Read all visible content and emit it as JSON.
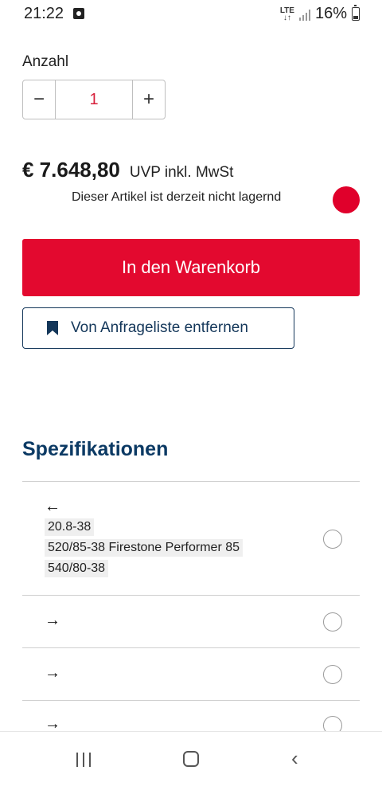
{
  "status_bar": {
    "time": "21:22",
    "network": "LTE",
    "battery": "16%"
  },
  "quantity": {
    "label": "Anzahl",
    "minus": "−",
    "value": "1",
    "plus": "+"
  },
  "price": {
    "amount": "€ 7.648,80",
    "note": "UVP inkl. MwSt"
  },
  "stock": {
    "text": "Dieser Artikel ist derzeit nicht lagernd",
    "indicator_color": "#e0002b"
  },
  "actions": {
    "cart_label": "In den Warenkorb",
    "request_label": "Von Anfrageliste entfernen"
  },
  "specs": {
    "title": "Spezifikationen",
    "rows": [
      {
        "arrow": "←",
        "tags": [
          "20.8-38",
          "520/85-38 Firestone Performer 85",
          "540/80-38"
        ]
      },
      {
        "arrow": "→"
      },
      {
        "arrow": "→"
      },
      {
        "arrow": "→"
      }
    ]
  },
  "colors": {
    "accent_red": "#e3092f",
    "navy": "#0c3a64"
  }
}
